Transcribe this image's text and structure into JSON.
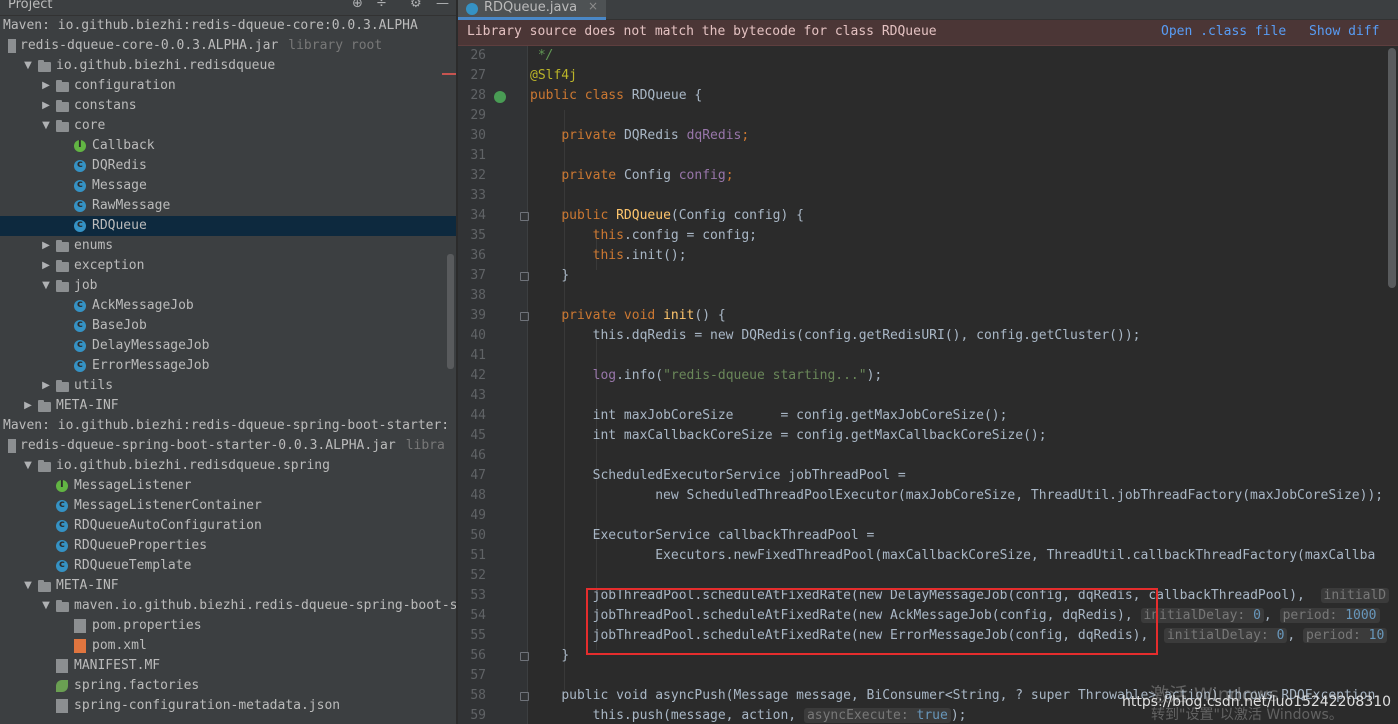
{
  "project_panel": {
    "title": "Project",
    "icons": [
      "target-icon",
      "collapse-icon",
      "gear-icon",
      "minimize-icon"
    ],
    "rows": [
      {
        "kind": "maven",
        "text": "Maven: io.github.biezhi:redis-dqueue-core:0.0.3.ALPHA",
        "indent": 0
      },
      {
        "kind": "jar",
        "text": "redis-dqueue-core-0.0.3.ALPHA.jar",
        "extra": "library root",
        "indent": 0
      },
      {
        "kind": "folder",
        "text": "io.github.biezhi.redisdqueue",
        "indent": 1,
        "arrow": "open"
      },
      {
        "kind": "folder",
        "text": "configuration",
        "indent": 2,
        "arrow": "closed"
      },
      {
        "kind": "folder",
        "text": "constans",
        "indent": 2,
        "arrow": "closed"
      },
      {
        "kind": "folder",
        "text": "core",
        "indent": 2,
        "arrow": "open"
      },
      {
        "kind": "itf",
        "text": "Callback",
        "indent": 3
      },
      {
        "kind": "cls",
        "text": "DQRedis",
        "indent": 3
      },
      {
        "kind": "cls",
        "text": "Message",
        "indent": 3
      },
      {
        "kind": "cls",
        "text": "RawMessage",
        "indent": 3
      },
      {
        "kind": "cls",
        "text": "RDQueue",
        "indent": 3,
        "selected": true
      },
      {
        "kind": "folder",
        "text": "enums",
        "indent": 2,
        "arrow": "closed"
      },
      {
        "kind": "folder",
        "text": "exception",
        "indent": 2,
        "arrow": "closed"
      },
      {
        "kind": "folder",
        "text": "job",
        "indent": 2,
        "arrow": "open"
      },
      {
        "kind": "cls",
        "text": "AckMessageJob",
        "indent": 3
      },
      {
        "kind": "cls",
        "text": "BaseJob",
        "indent": 3
      },
      {
        "kind": "cls",
        "text": "DelayMessageJob",
        "indent": 3
      },
      {
        "kind": "cls",
        "text": "ErrorMessageJob",
        "indent": 3
      },
      {
        "kind": "folder",
        "text": "utils",
        "indent": 2,
        "arrow": "closed"
      },
      {
        "kind": "folder",
        "text": "META-INF",
        "indent": 1,
        "arrow": "closed"
      },
      {
        "kind": "maven",
        "text": "Maven: io.github.biezhi:redis-dqueue-spring-boot-starter:",
        "indent": 0
      },
      {
        "kind": "jar",
        "text": "redis-dqueue-spring-boot-starter-0.0.3.ALPHA.jar",
        "extra": "libra",
        "indent": 0
      },
      {
        "kind": "folder",
        "text": "io.github.biezhi.redisdqueue.spring",
        "indent": 1,
        "arrow": "open"
      },
      {
        "kind": "itf",
        "text": "MessageListener",
        "indent": 2
      },
      {
        "kind": "cls",
        "text": "MessageListenerContainer",
        "indent": 2
      },
      {
        "kind": "cls",
        "text": "RDQueueAutoConfiguration",
        "indent": 2
      },
      {
        "kind": "cls",
        "text": "RDQueueProperties",
        "indent": 2
      },
      {
        "kind": "cls",
        "text": "RDQueueTemplate",
        "indent": 2
      },
      {
        "kind": "folder",
        "text": "META-INF",
        "indent": 1,
        "arrow": "open"
      },
      {
        "kind": "folder",
        "text": "maven.io.github.biezhi.redis-dqueue-spring-boot-st",
        "indent": 2,
        "arrow": "open"
      },
      {
        "kind": "props",
        "text": "pom.properties",
        "indent": 3
      },
      {
        "kind": "xml",
        "text": "pom.xml",
        "indent": 3
      },
      {
        "kind": "mf",
        "text": "MANIFEST.MF",
        "indent": 2
      },
      {
        "kind": "spring",
        "text": "spring.factories",
        "indent": 2
      },
      {
        "kind": "json",
        "text": "spring-configuration-metadata.json",
        "indent": 2
      }
    ]
  },
  "editor": {
    "tab": {
      "name": "RDQueue.java",
      "close": "×"
    },
    "banner": {
      "message": "Library source does not match the bytecode for class RDQueue",
      "open_link": "Open .class file",
      "diff_link": "Show diff"
    },
    "line_numbers": [
      "26",
      "27",
      "28",
      "29",
      "30",
      "31",
      "32",
      "33",
      "34",
      "35",
      "36",
      "37",
      "38",
      "39",
      "40",
      "41",
      "42",
      "43",
      "44",
      "45",
      "46",
      "47",
      "48",
      "49",
      "50",
      "51",
      "52",
      "53",
      "54",
      "55",
      "56",
      "57",
      "58",
      "59"
    ],
    "code": {
      "l26": " */",
      "l27": "@Slf4j",
      "l28_kw": "public class ",
      "l28_name": "RDQueue {",
      "l30_kw": "private ",
      "l30_type": "DQRedis ",
      "l30_field": "dqRedis",
      "l32_kw": "private ",
      "l32_type": "Config ",
      "l32_field": "config",
      "l34_kw": "public ",
      "l34_name": "RDQueue",
      "l34_args": "(Config config) {",
      "l35_this": "this",
      "l35_rest": ".config = config;",
      "l36_this": "this",
      "l36_rest": ".init();",
      "l37": "}",
      "l39_kw": "private void ",
      "l39_name": "init",
      "l39_rest": "() {",
      "l40": "this.dqRedis = new DQRedis(config.getRedisURI(), config.getCluster());",
      "l42_log": "log",
      "l42_rest": ".info(",
      "l42_str": "\"redis-dqueue starting...\"",
      "l42_end": ");",
      "l44": "int maxJobCoreSize      = config.getMaxJobCoreSize();",
      "l45": "int maxCallbackCoreSize = config.getMaxCallbackCoreSize();",
      "l47": "ScheduledExecutorService jobThreadPool =",
      "l48": "new ScheduledThreadPoolExecutor(maxJobCoreSize, ThreadUtil.jobThreadFactory(maxJobCoreSize));",
      "l50": "ExecutorService callbackThreadPool =",
      "l51": "Executors.newFixedThreadPool(maxCallbackCoreSize, ThreadUtil.callbackThreadFactory(maxCallba",
      "l53": "jobThreadPool.scheduleAtFixedRate(new DelayMessageJob(config, dqRedis, callbackThreadPool),",
      "l53_hint": "initialD",
      "l54": "jobThreadPool.scheduleAtFixedRate(new AckMessageJob(config, dqRedis),",
      "l54_hint1": "initialDelay:",
      "l54_val1": "0",
      "l54_hint2": "period:",
      "l54_val2": "1000",
      "l55": "jobThreadPool.scheduleAtFixedRate(new ErrorMessageJob(config, dqRedis),",
      "l55_hint1": "initialDelay:",
      "l55_val1": "0",
      "l55_hint2": "period:",
      "l55_val2": "10",
      "l56": "}",
      "l58": "public void asyncPush(Message message, BiConsumer<String, ? super Throwable> action) throws RDQException",
      "l59": "this.push(message, action,",
      "l59_hint": "asyncExecute:",
      "l59_val": "true",
      "l59_end": ");"
    }
  },
  "overlay": {
    "watermark_line1": "激活 Windows",
    "watermark_line2": "转到\"设置\"以激活 Windows。",
    "url": "https://blog.csdn.net/luo15242208310"
  },
  "colors": {
    "selection": "#0d293e",
    "banner_bg": "#4b3636",
    "link": "#589df6",
    "highlight_box": "#e52d2d"
  }
}
